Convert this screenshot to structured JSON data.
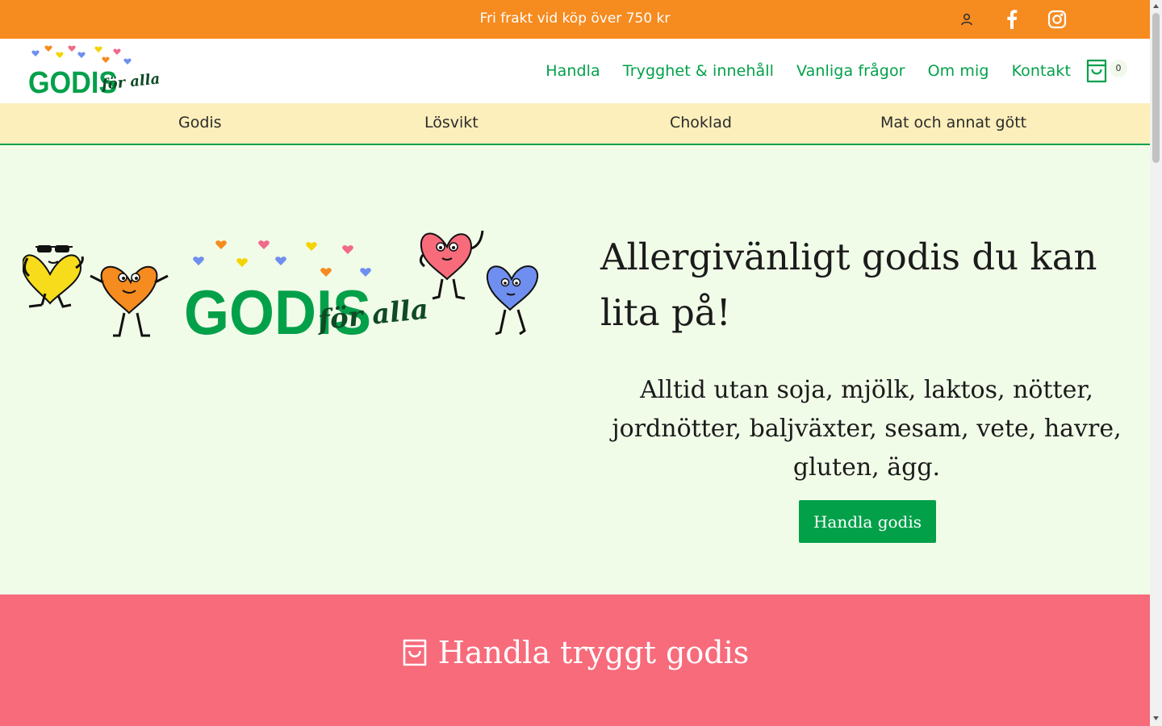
{
  "topbar": {
    "message": "Fri frakt vid köp över 750 kr",
    "icons": [
      "user-icon",
      "facebook-icon",
      "instagram-icon"
    ]
  },
  "brand": {
    "logo_word_main": "GODIS",
    "logo_word_script": "för alla"
  },
  "nav": {
    "items": [
      "Handla",
      "Trygghet & innehåll",
      "Vanliga frågor",
      "Om mig",
      "Kontakt"
    ],
    "cart_count": "0"
  },
  "categories": [
    "Godis",
    "Lösvikt",
    "Choklad",
    "Mat och annat gött"
  ],
  "hero": {
    "title": "Allergivänligt godis du kan lita på!",
    "subtitle": "Alltid utan soja, mjölk, laktos, nötter, jordnötter, baljväxter, sesam, vete, havre, gluten, ägg.",
    "button_label": "Handla godis"
  },
  "section": {
    "title": "Handla tryggt godis",
    "icon": "shopping-bag-icon"
  },
  "colors": {
    "topbar": "#f68b1f",
    "accent_green": "#03a04a",
    "category_bar": "#fdefbb",
    "hero_bg": "#f1fce8",
    "section_pink": "#f76b7b"
  }
}
